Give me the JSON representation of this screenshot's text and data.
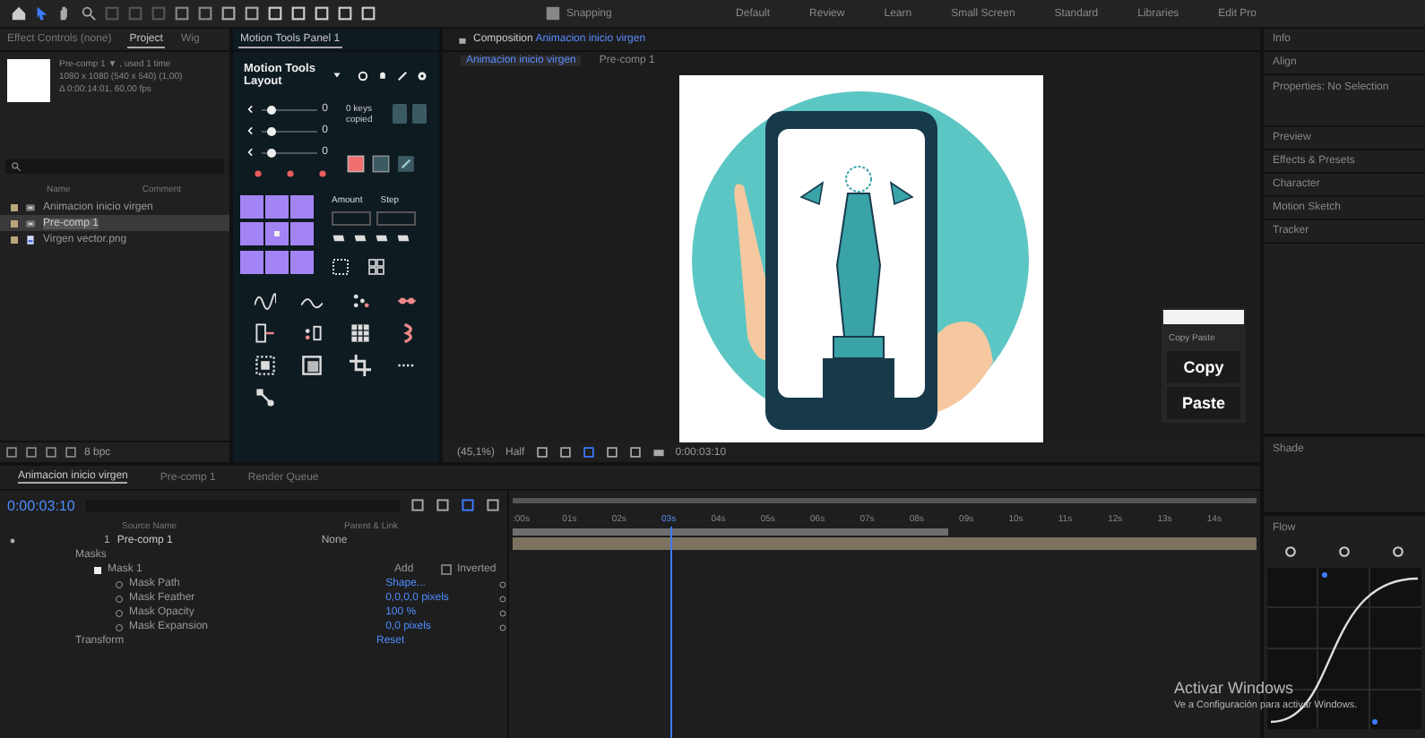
{
  "toolbar": {
    "snapping_label": "Snapping",
    "workspaces": [
      "Default",
      "Review",
      "Learn",
      "Small Screen",
      "Standard",
      "Libraries",
      "Edit Pro"
    ]
  },
  "project_panel": {
    "tabs": [
      {
        "label": "Effect Controls (none)",
        "selected": false
      },
      {
        "label": "Project",
        "selected": true
      },
      {
        "label": "Wig",
        "selected": false
      }
    ],
    "info": [
      "Pre-comp 1 ▼ , used 1 time",
      "1080 x 1080  (540 x 540) (1,00)",
      "Δ 0:00:14:01, 60,00 fps"
    ],
    "columns": [
      "Name",
      "Comment"
    ],
    "items": [
      {
        "name": "Animacion inicio virgen",
        "kind": "comp",
        "selected": false
      },
      {
        "name": "Pre-comp 1",
        "kind": "comp",
        "selected": true
      },
      {
        "name": "Virgen vector.png",
        "kind": "image",
        "selected": false
      }
    ],
    "bit_depth": "8 bpc"
  },
  "motion_tools": {
    "tab": "Motion Tools Panel 1",
    "layout_title": "Motion Tools Layout",
    "sliders": [
      {
        "value": "0",
        "level": 0.15
      },
      {
        "value": "0",
        "level": 0.15
      },
      {
        "value": "0",
        "level": 0.15
      }
    ],
    "keys_copied": "0 keys copied",
    "amount_label": "Amount",
    "step_label": "Step"
  },
  "composition": {
    "title_prefix": "Composition",
    "title_name": "Animacion inicio virgen",
    "tabs": [
      {
        "label": "Animacion inicio virgen",
        "selected": true
      },
      {
        "label": "Pre-comp 1",
        "selected": false
      }
    ],
    "zoom": "(45,1%)",
    "resolution": "Half",
    "timecode": "0:00:03:10"
  },
  "copy_paste": {
    "title": "Copy Paste",
    "buttons": [
      "Copy",
      "Paste"
    ]
  },
  "right_panel": {
    "items": [
      "Info",
      "Align",
      "Properties: No Selection",
      "Preview",
      "Effects & Presets",
      "Character",
      "Motion Sketch",
      "Tracker"
    ],
    "shade_title": "Shade",
    "flow_title": "Flow"
  },
  "timeline": {
    "tabs": [
      {
        "label": "Animacion inicio virgen",
        "selected": true
      },
      {
        "label": "Pre-comp 1",
        "selected": false
      },
      {
        "label": "Render Queue",
        "selected": false
      }
    ],
    "timecode": "0:00:03:10",
    "source_column": "Source Name",
    "parent_column": "Parent & Link",
    "layer": {
      "number": "1",
      "name": "Pre-comp 1",
      "parent": "None"
    },
    "rows": [
      {
        "kind": "group",
        "label": "Masks"
      },
      {
        "kind": "mask",
        "label": "Mask 1",
        "mode": "Add",
        "inverted_label": "Inverted",
        "inverted": false
      },
      {
        "kind": "property",
        "label": "Mask Path",
        "value": "Shape..."
      },
      {
        "kind": "property",
        "label": "Mask Feather",
        "value": "0,0,0,0 pixels"
      },
      {
        "kind": "property",
        "label": "Mask Opacity",
        "value": "100 %"
      },
      {
        "kind": "property",
        "label": "Mask Expansion",
        "value": "0,0 pixels"
      },
      {
        "kind": "group",
        "label": "Transform",
        "value": "Reset"
      }
    ],
    "ruler": [
      {
        "label": ":00s",
        "selected": false
      },
      {
        "label": "01s",
        "selected": false
      },
      {
        "label": "02s",
        "selected": false
      },
      {
        "label": "03s",
        "selected": true
      },
      {
        "label": "04s",
        "selected": false
      },
      {
        "label": "05s",
        "selected": false
      },
      {
        "label": "06s",
        "selected": false
      },
      {
        "label": "07s",
        "selected": false
      },
      {
        "label": "08s",
        "selected": false
      },
      {
        "label": "09s",
        "selected": false
      },
      {
        "label": "10s",
        "selected": false
      },
      {
        "label": "11s",
        "selected": false
      },
      {
        "label": "12s",
        "selected": false
      },
      {
        "label": "13s",
        "selected": false
      },
      {
        "label": "14s",
        "selected": false
      }
    ]
  },
  "os_notice": {
    "title": "Activar Windows",
    "text": "Ve a Configuración para activar Windows."
  }
}
